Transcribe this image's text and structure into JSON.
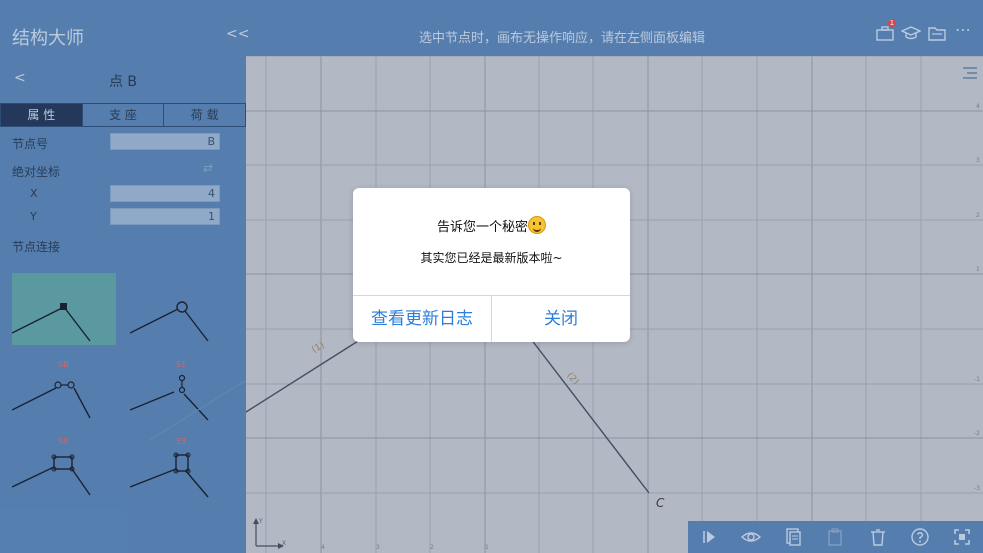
{
  "app": {
    "title": "结构大师",
    "collapse": "<<",
    "hint": "选中节点时，画布无操作响应，请在左侧面板编辑"
  },
  "header_icons": {
    "badge": "1",
    "more": "⋯"
  },
  "panel": {
    "back": "<",
    "title": "点 B",
    "tabs": [
      "属 性",
      "支 座",
      "荷 载"
    ],
    "node_no_label": "节点号",
    "node_no_value": "B",
    "abs_coord_label": "绝对坐标",
    "x_label": "X",
    "x_value": "4",
    "y_label": "Y",
    "y_value": "1",
    "conn_label": "节点连接",
    "codes": [
      "SB",
      "S1",
      "S8",
      "S3"
    ]
  },
  "canvas": {
    "node_label": "C",
    "member_labels": [
      "(1)",
      "(2)"
    ],
    "axis_labels": {
      "y": "Y",
      "x": "X"
    },
    "left_ticks": [
      "4",
      "3",
      "2",
      "1"
    ],
    "right_ticks": [
      "4",
      "3",
      "2",
      "1",
      "-1",
      "-2",
      "-3",
      "-4"
    ]
  },
  "dialog": {
    "title": "告诉您一个秘密",
    "message": "其实您已经是最新版本啦~",
    "btn_log": "查看更新日志",
    "btn_close": "关闭"
  }
}
